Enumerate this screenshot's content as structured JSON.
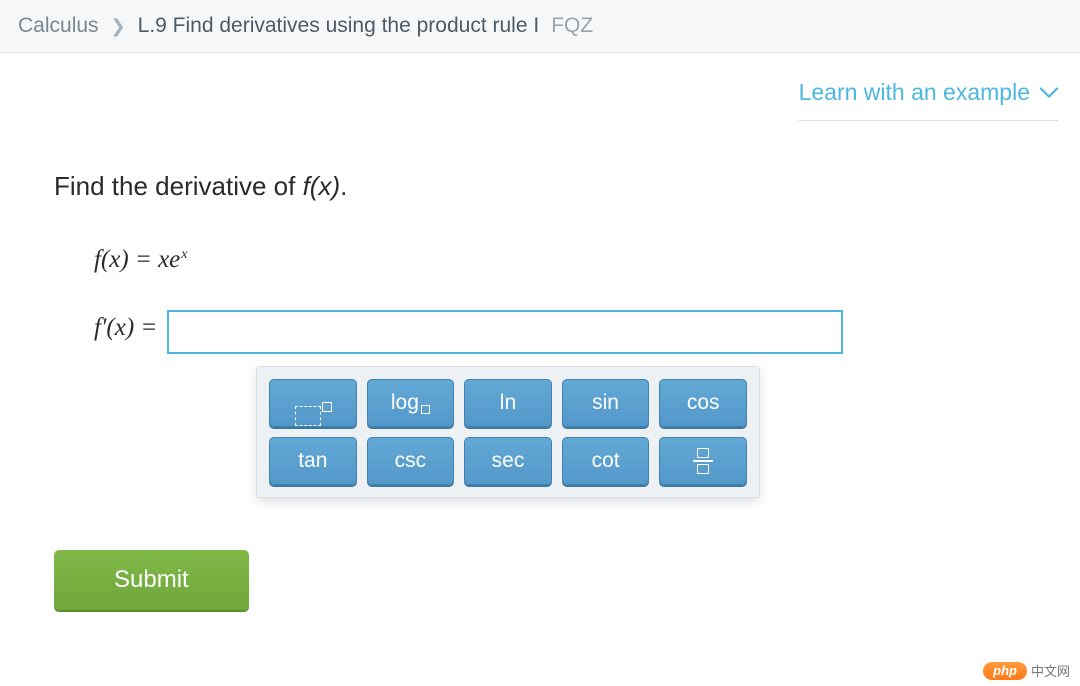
{
  "breadcrumb": {
    "subject": "Calculus",
    "skill": "L.9 Find derivatives using the product rule I",
    "code": "FQZ"
  },
  "learn_example": "Learn with an example",
  "question": {
    "prompt_prefix": "Find the derivative of ",
    "prompt_fx": "f(x)",
    "prompt_suffix": ".",
    "given_label": "f(x) = xe",
    "given_sup": "x",
    "answer_label": "f′(x) = "
  },
  "palette": {
    "row1": [
      "exp",
      "log",
      "ln",
      "sin",
      "cos"
    ],
    "row2": [
      "tan",
      "csc",
      "sec",
      "cot",
      "frac"
    ]
  },
  "submit": "Submit",
  "footer": {
    "brand": "php",
    "text": "中文网"
  }
}
